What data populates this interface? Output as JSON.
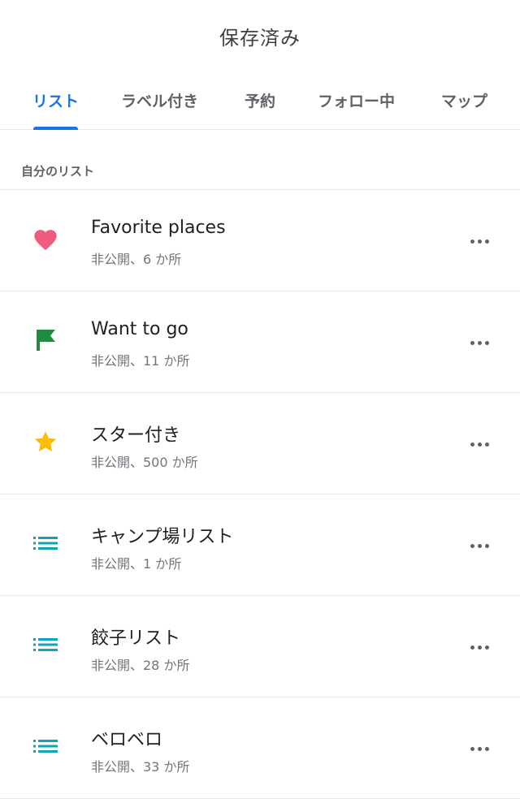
{
  "header": {
    "title": "保存済み"
  },
  "tabs": [
    {
      "label": "リスト",
      "active": true
    },
    {
      "label": "ラベル付き",
      "active": false
    },
    {
      "label": "予約",
      "active": false
    },
    {
      "label": "フォロー中",
      "active": false
    },
    {
      "label": "マップ",
      "active": false
    }
  ],
  "section": {
    "title": "自分のリスト"
  },
  "lists": [
    {
      "icon": "heart-icon",
      "icon_color": "#f05a7e",
      "title": "Favorite places",
      "subtitle": "非公開、6 か所"
    },
    {
      "icon": "flag-icon",
      "icon_color": "#1e8e3e",
      "title": "Want to go",
      "subtitle": "非公開、11 か所"
    },
    {
      "icon": "star-icon",
      "icon_color": "#fbbc04",
      "title": "スター付き",
      "subtitle": "非公開、500 か所"
    },
    {
      "icon": "list-icon",
      "icon_color": "#12a4af",
      "title": "キャンプ場リスト",
      "subtitle": "非公開、1 か所"
    },
    {
      "icon": "list-icon",
      "icon_color": "#12a4af",
      "title": "餃子リスト",
      "subtitle": "非公開、28 か所"
    },
    {
      "icon": "list-icon",
      "icon_color": "#12a4af",
      "title": "ベロベロ",
      "subtitle": "非公開、33 か所"
    }
  ],
  "colors": {
    "accent": "#1a73e8"
  }
}
